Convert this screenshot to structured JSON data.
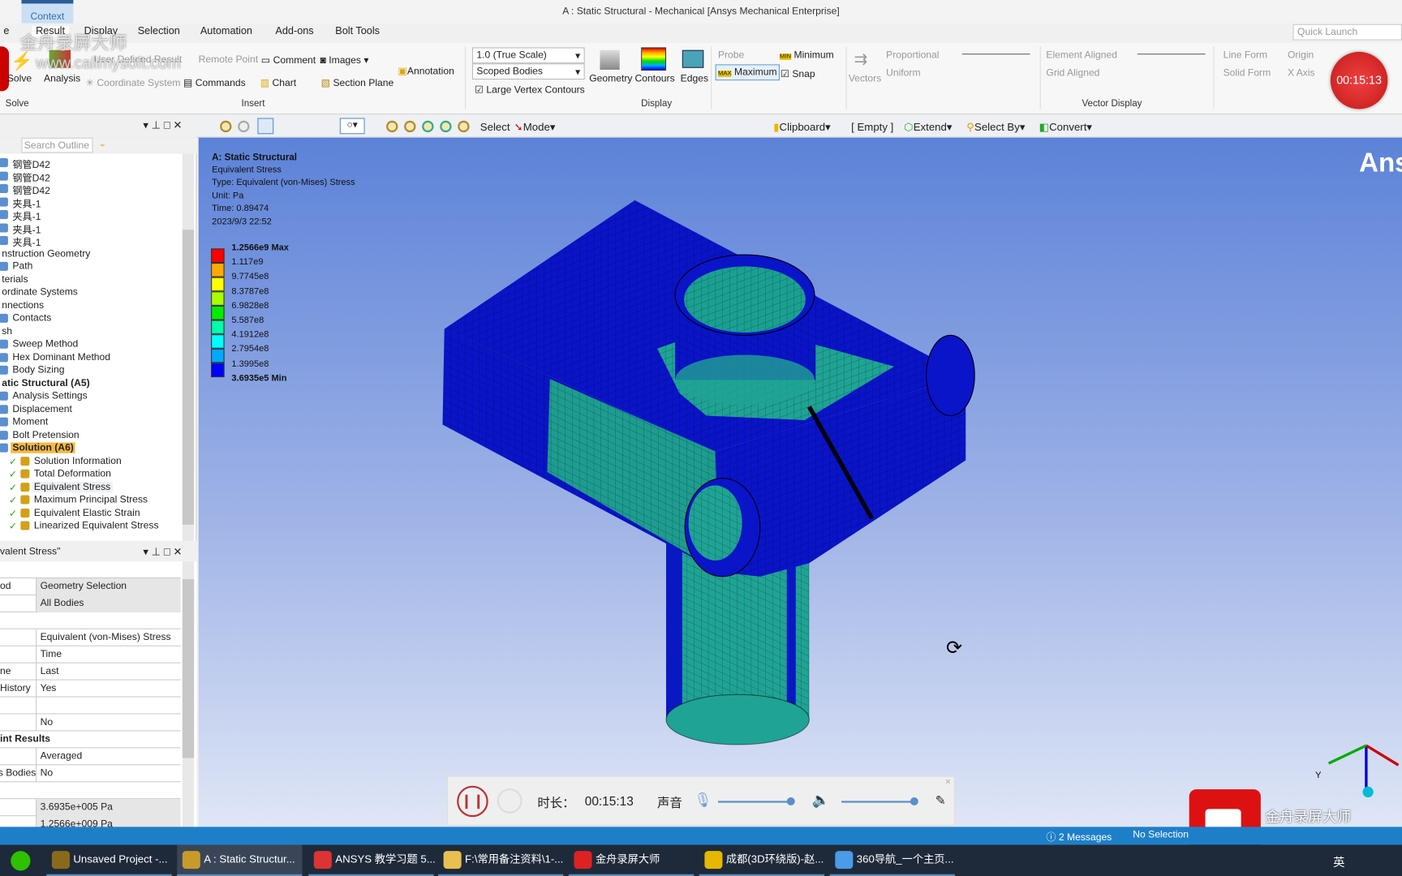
{
  "window": {
    "title": "A : Static Structural - Mechanical [Ansys Mechanical Enterprise]",
    "context_tab": "Context",
    "quick_launch_placeholder": "Quick Launch"
  },
  "tabs": [
    "e",
    "Result",
    "Display",
    "Selection",
    "Automation",
    "Add-ons",
    "Bolt Tools"
  ],
  "ribbon": {
    "solve": "Solve",
    "analysis": "Analysis",
    "user_defined": "User Defined Result",
    "remote_point": "Remote Point",
    "comment": "Comment",
    "images": "Images",
    "coordinate_system": "Coordinate System",
    "commands": "Commands",
    "chart": "Chart",
    "section_plane": "Section Plane",
    "annotation": "Annotation",
    "scale": "1.0 (True Scale)",
    "scope": "Scoped Bodies",
    "large_vertex": "Large Vertex Contours",
    "geometry": "Geometry",
    "contours": "Contours",
    "edges": "Edges",
    "probe": "Probe",
    "minimum": "Minimum",
    "maximum": "Maximum",
    "snap": "Snap",
    "vectors": "Vectors",
    "proportional": "Proportional",
    "uniform": "Uniform",
    "element_aligned": "Element Aligned",
    "grid_aligned": "Grid Aligned",
    "line_form": "Line Form",
    "solid_form": "Solid Form",
    "origin": "Origin",
    "x_axis": "X Axis",
    "groups": {
      "solve": "Solve",
      "insert": "Insert",
      "display": "Display",
      "vector_display": "Vector Display"
    }
  },
  "recording_badge": "00:15:13",
  "toolbar": {
    "select": "Select",
    "mode": "Mode",
    "clipboard": "Clipboard",
    "empty": "[ Empty ]",
    "extend": "Extend",
    "select_by": "Select By",
    "convert": "Convert"
  },
  "outline": {
    "search_placeholder": "Search Outline",
    "items": [
      {
        "label": "钢管D42",
        "indent": 0
      },
      {
        "label": "钢管D42",
        "indent": 0
      },
      {
        "label": "钢管D42",
        "indent": 0
      },
      {
        "label": "夹具-1",
        "indent": 0
      },
      {
        "label": "夹具-1",
        "indent": 0
      },
      {
        "label": "夹具-1",
        "indent": 0
      },
      {
        "label": "夹具-1",
        "indent": 0
      },
      {
        "label": "nstruction Geometry",
        "indent": -1
      },
      {
        "label": "Path",
        "indent": 0
      },
      {
        "label": "terials",
        "indent": -1
      },
      {
        "label": "ordinate Systems",
        "indent": -1
      },
      {
        "label": "nnections",
        "indent": -1
      },
      {
        "label": "Contacts",
        "indent": 0
      },
      {
        "label": "sh",
        "indent": -1
      },
      {
        "label": "Sweep Method",
        "indent": 0
      },
      {
        "label": "Hex Dominant Method",
        "indent": 0
      },
      {
        "label": "Body Sizing",
        "indent": 0
      },
      {
        "label": "atic Structural (A5)",
        "indent": -1,
        "bold": true
      },
      {
        "label": "Analysis Settings",
        "indent": 0
      },
      {
        "label": "Displacement",
        "indent": 0
      },
      {
        "label": "Moment",
        "indent": 0
      },
      {
        "label": "Bolt Pretension",
        "indent": 0
      },
      {
        "label": "Solution (A6)",
        "indent": 0,
        "bold": true,
        "highlight": true
      },
      {
        "label": "Solution Information",
        "indent": 1
      },
      {
        "label": "Total Deformation",
        "indent": 1
      },
      {
        "label": "Equivalent Stress",
        "indent": 1,
        "selected": true
      },
      {
        "label": "Maximum Principal Stress",
        "indent": 1
      },
      {
        "label": "Equivalent Elastic Strain",
        "indent": 1
      },
      {
        "label": "Linearized Equivalent Stress",
        "indent": 1
      }
    ]
  },
  "details": {
    "title": "valent Stress\"",
    "rows": [
      {
        "k": "",
        "v": "",
        "section": true
      },
      {
        "k": "od",
        "v": "Geometry Selection",
        "grey": true
      },
      {
        "k": "",
        "v": "All Bodies",
        "grey": true
      },
      {
        "k": "",
        "v": "",
        "section": true
      },
      {
        "k": "",
        "v": "Equivalent (von-Mises) Stress"
      },
      {
        "k": "",
        "v": "Time"
      },
      {
        "k": "ne",
        "v": "Last"
      },
      {
        "k": "History",
        "v": "Yes"
      },
      {
        "k": "",
        "v": ""
      },
      {
        "k": "",
        "v": "No"
      },
      {
        "k": "int Results",
        "v": "",
        "section": true,
        "bold": true
      },
      {
        "k": "",
        "v": "Averaged"
      },
      {
        "k": "s Bodies",
        "v": "No"
      },
      {
        "k": "",
        "v": "",
        "section": true
      },
      {
        "k": "",
        "v": "3.6935e+005 Pa",
        "grey": true
      },
      {
        "k": "",
        "v": "1.2566e+009 Pa",
        "grey": true
      }
    ]
  },
  "viewport": {
    "analysis": "A: Static Structural",
    "result": "Equivalent Stress",
    "type": "Type: Equivalent (von-Mises) Stress",
    "unit": "Unit: Pa",
    "time": "Time: 0.89474",
    "date": "2023/9/3 22:52",
    "logo": "Ansys",
    "legend": [
      {
        "label": "1.2566e9 Max",
        "color": "#ff0000",
        "bold": true
      },
      {
        "label": "1.117e9",
        "color": "#ffaa00"
      },
      {
        "label": "9.7745e8",
        "color": "#ffff00"
      },
      {
        "label": "8.3787e8",
        "color": "#aaff00"
      },
      {
        "label": "6.9828e8",
        "color": "#00ee00"
      },
      {
        "label": "5.587e8",
        "color": "#00ffaa"
      },
      {
        "label": "4.1912e8",
        "color": "#00ffff"
      },
      {
        "label": "2.7954e8",
        "color": "#00aaff"
      },
      {
        "label": "1.3995e8",
        "color": "#0000ff"
      },
      {
        "label": "3.6935e5 Min",
        "color": null,
        "bold": true
      }
    ],
    "triad_y": "Y"
  },
  "recorder": {
    "duration_label": "时长：",
    "duration": "00:15:13",
    "sound_label": "声音",
    "mic_level": 1.0,
    "speaker_level": 1.0
  },
  "status": {
    "messages": "2 Messages",
    "selection": "No Selection"
  },
  "watermark": {
    "text1": "金舟录屏大师",
    "text2": "www.callmysoft.com"
  },
  "taskbar": [
    {
      "label": "Unsaved Project -...",
      "color": "#8a6a1a"
    },
    {
      "label": "A : Static Structur...",
      "color": "#c89a2a"
    },
    {
      "label": "ANSYS 教学习题 5...",
      "color": "#d33"
    },
    {
      "label": "F:\\常用备注资料\\1-...",
      "color": "#e8c050"
    },
    {
      "label": "金舟录屏大师",
      "color": "#d22"
    },
    {
      "label": "成都(3D环绕版)-赵...",
      "color": "#e6b800"
    },
    {
      "label": "360导航_一个主页...",
      "color": "#4a9be8"
    }
  ],
  "tray": {
    "ime": "英"
  }
}
